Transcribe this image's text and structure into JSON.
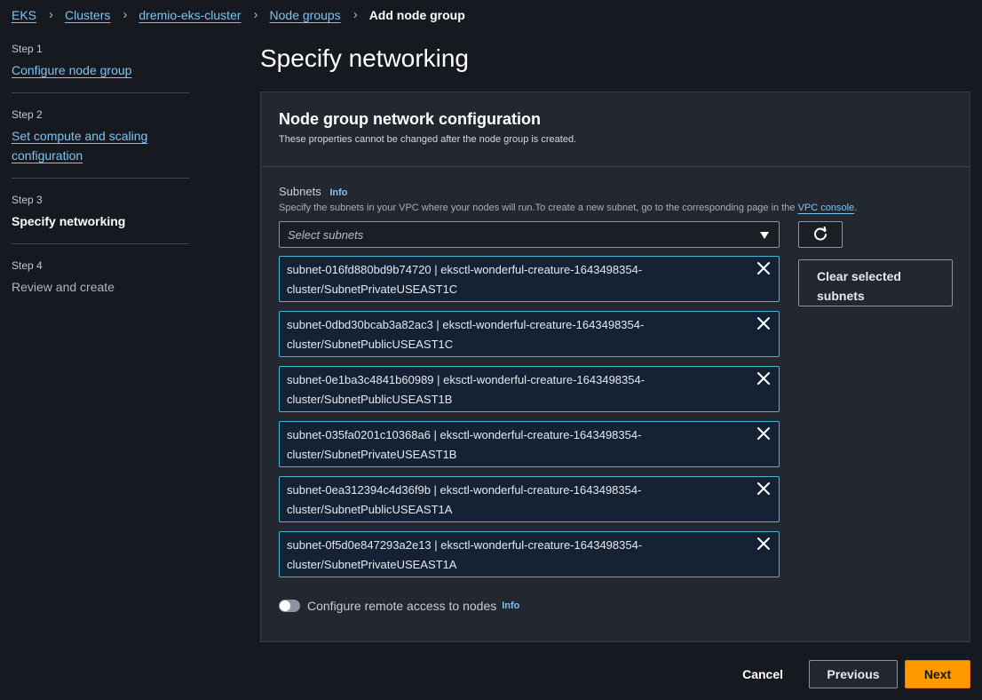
{
  "breadcrumb": {
    "items": [
      "EKS",
      "Clusters",
      "dremio-eks-cluster",
      "Node groups"
    ],
    "current": "Add node group"
  },
  "steps": [
    {
      "num": "Step 1",
      "label": "Configure node group"
    },
    {
      "num": "Step 2",
      "label": "Set compute and scaling configuration"
    },
    {
      "num": "Step 3",
      "label": "Specify networking"
    },
    {
      "num": "Step 4",
      "label": "Review and create"
    }
  ],
  "page": {
    "title": "Specify networking"
  },
  "panel": {
    "title": "Node group network configuration",
    "description": "These properties cannot be changed after the node group is created."
  },
  "subnets": {
    "label": "Subnets",
    "info": "Info",
    "description_pre": "Specify the subnets in your VPC where your nodes will run.To create a new subnet, go to the corresponding page in the ",
    "description_link": "VPC console",
    "description_post": ".",
    "placeholder": "Select subnets",
    "clear_label": "Clear selected subnets",
    "selected": [
      {
        "line1": "subnet-016fd880bd9b74720 | eksctl-wonderful-creature-1643498354-",
        "line2": "cluster/SubnetPrivateUSEAST1C"
      },
      {
        "line1": "subnet-0dbd30bcab3a82ac3 | eksctl-wonderful-creature-1643498354-",
        "line2": "cluster/SubnetPublicUSEAST1C"
      },
      {
        "line1": "subnet-0e1ba3c4841b60989 | eksctl-wonderful-creature-1643498354-",
        "line2": "cluster/SubnetPublicUSEAST1B"
      },
      {
        "line1": "subnet-035fa0201c10368a6 | eksctl-wonderful-creature-1643498354-",
        "line2": "cluster/SubnetPrivateUSEAST1B"
      },
      {
        "line1": "subnet-0ea312394c4d36f9b | eksctl-wonderful-creature-1643498354-",
        "line2": "cluster/SubnetPublicUSEAST1A"
      },
      {
        "line1": "subnet-0f5d0e847293a2e13 | eksctl-wonderful-creature-1643498354-",
        "line2": "cluster/SubnetPrivateUSEAST1A"
      }
    ]
  },
  "remote_access": {
    "label": "Configure remote access to nodes",
    "info": "Info",
    "enabled": false
  },
  "actions": {
    "cancel": "Cancel",
    "previous": "Previous",
    "next": "Next"
  },
  "colors": {
    "accent": "#ff9900",
    "link": "#7dc4f3",
    "token_border": "#44b9d6",
    "background": "#16191f"
  }
}
